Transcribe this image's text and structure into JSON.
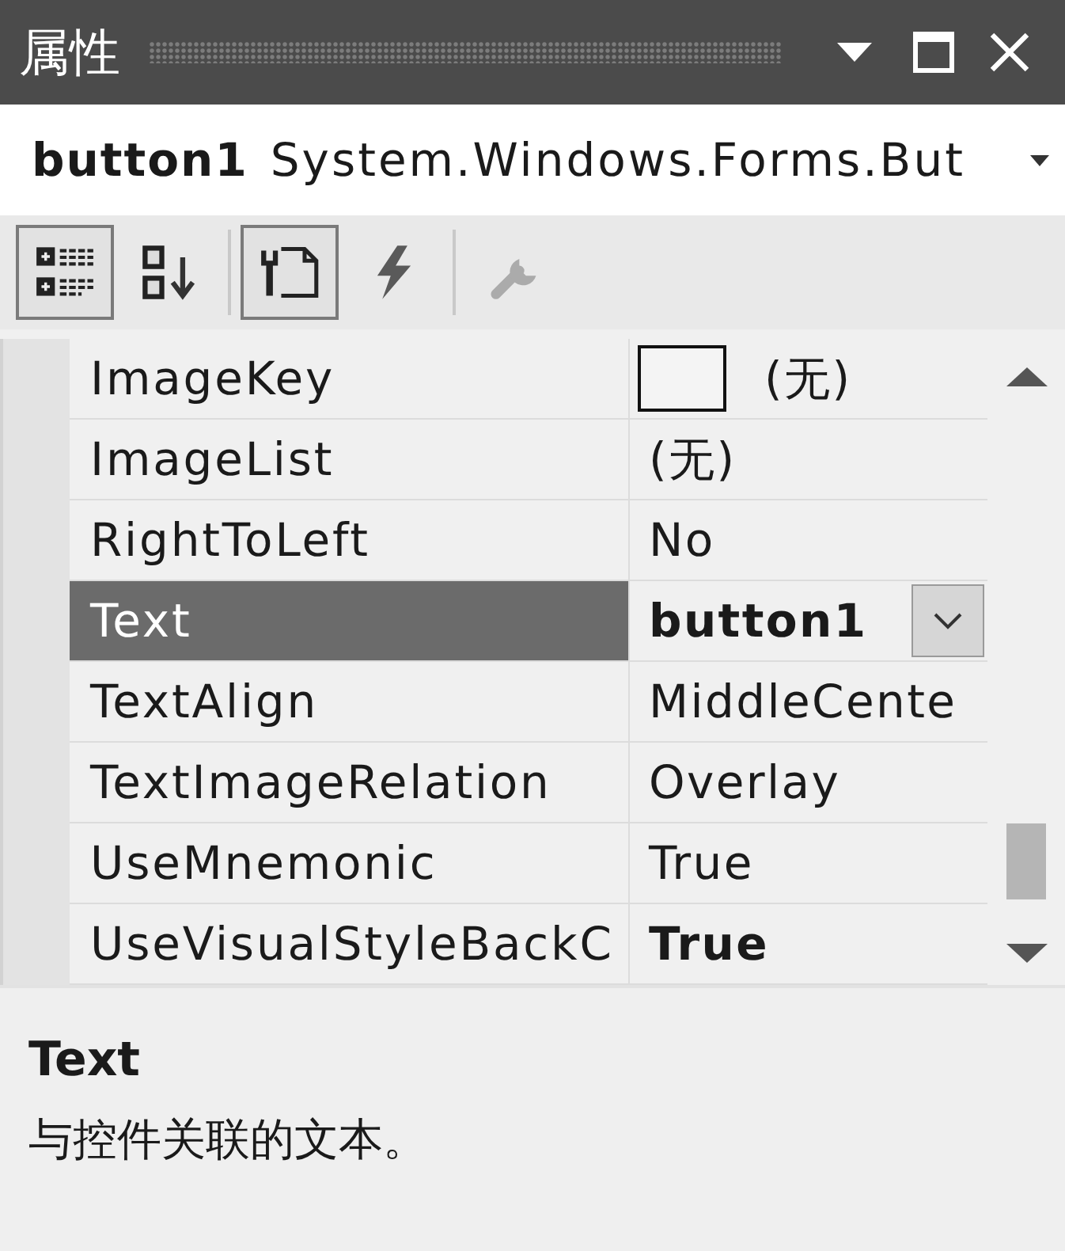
{
  "window": {
    "title": "属性"
  },
  "object_selector": {
    "name": "button1",
    "type": "System.Windows.Forms.But"
  },
  "toolbar": {
    "groups": [
      {
        "buttons": [
          {
            "kind": "categorized",
            "selected": true,
            "disabled": false
          },
          {
            "kind": "alphabetical",
            "selected": false,
            "disabled": false
          }
        ]
      },
      {
        "buttons": [
          {
            "kind": "properties",
            "selected": true,
            "disabled": false
          },
          {
            "kind": "events",
            "selected": false,
            "disabled": false
          }
        ]
      },
      {
        "buttons": [
          {
            "kind": "property_pages",
            "selected": false,
            "disabled": true
          }
        ]
      }
    ]
  },
  "grid": {
    "rows": [
      {
        "name": "ImageKey",
        "value": "(无)",
        "preview": true,
        "modified": false,
        "selected": false,
        "dropdown": false
      },
      {
        "name": "ImageList",
        "value": "(无)",
        "preview": false,
        "modified": false,
        "selected": false,
        "dropdown": false
      },
      {
        "name": "RightToLeft",
        "value": "No",
        "preview": false,
        "modified": false,
        "selected": false,
        "dropdown": false
      },
      {
        "name": "Text",
        "value": "button1",
        "preview": false,
        "modified": true,
        "selected": true,
        "dropdown": true
      },
      {
        "name": "TextAlign",
        "value": "MiddleCente",
        "preview": false,
        "modified": false,
        "selected": false,
        "dropdown": false
      },
      {
        "name": "TextImageRelation",
        "value": "Overlay",
        "preview": false,
        "modified": false,
        "selected": false,
        "dropdown": false
      },
      {
        "name": "UseMnemonic",
        "value": "True",
        "preview": false,
        "modified": false,
        "selected": false,
        "dropdown": false
      },
      {
        "name": "UseVisualStyleBackC",
        "value": "True",
        "preview": false,
        "modified": true,
        "selected": false,
        "dropdown": false
      }
    ]
  },
  "description": {
    "title": "Text",
    "text": "与控件关联的文本。"
  }
}
